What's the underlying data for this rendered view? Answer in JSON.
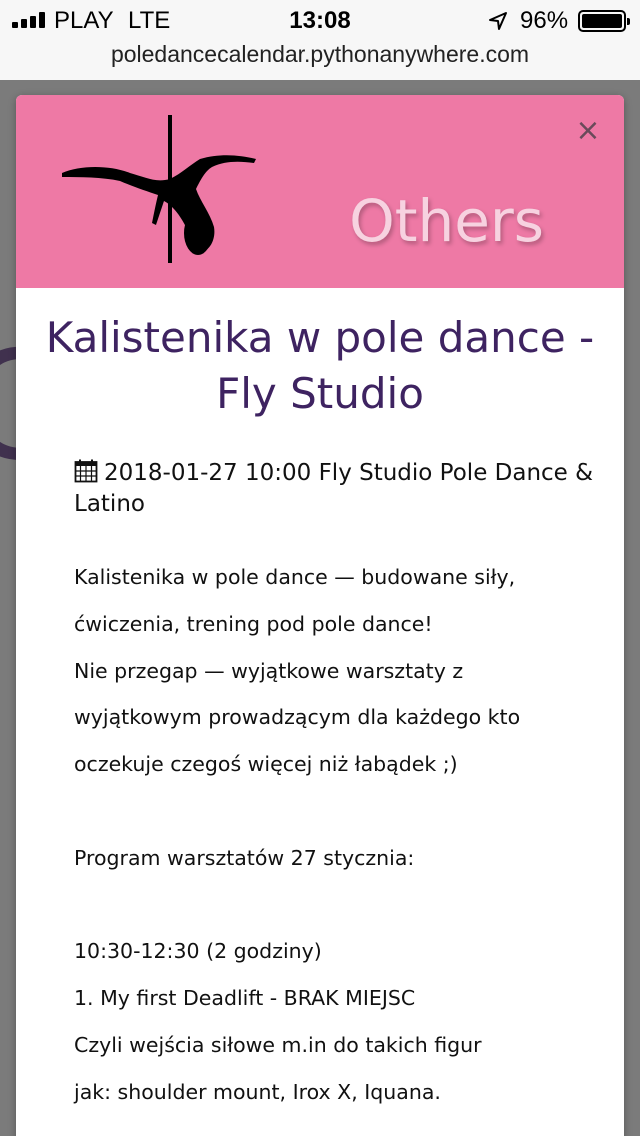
{
  "status_bar": {
    "carrier": "PLAY",
    "network": "LTE",
    "time": "13:08",
    "battery": "96%"
  },
  "browser": {
    "url": "poledancecalendar.pythonanywhere.com"
  },
  "modal": {
    "header_color": "#ee79a5",
    "category": "Others",
    "close_label": "×",
    "title": "Kalistenika w pole dance - Fly Studio",
    "meta": "2018-01-27 10:00 Fly Studio Pole Dance & Latino",
    "description": "Kalistenika w pole dance — budowane siły,\nćwiczenia, trening pod pole dance!\nNie przegap — wyjątkowe warsztaty z\nwyjątkowym prowadzącym dla każdego kto\noczekuje czegoś więcej niż łabądek ;)\n\nProgram warsztatów 27 stycznia:\n\n10:30-12:30 (2 godziny)\n1. My first Deadlift - BRAK MIEJSC\nCzyli wejścia siłowe m.in do takich figur\njak: shoulder mount, Irox X, Iquana."
  }
}
